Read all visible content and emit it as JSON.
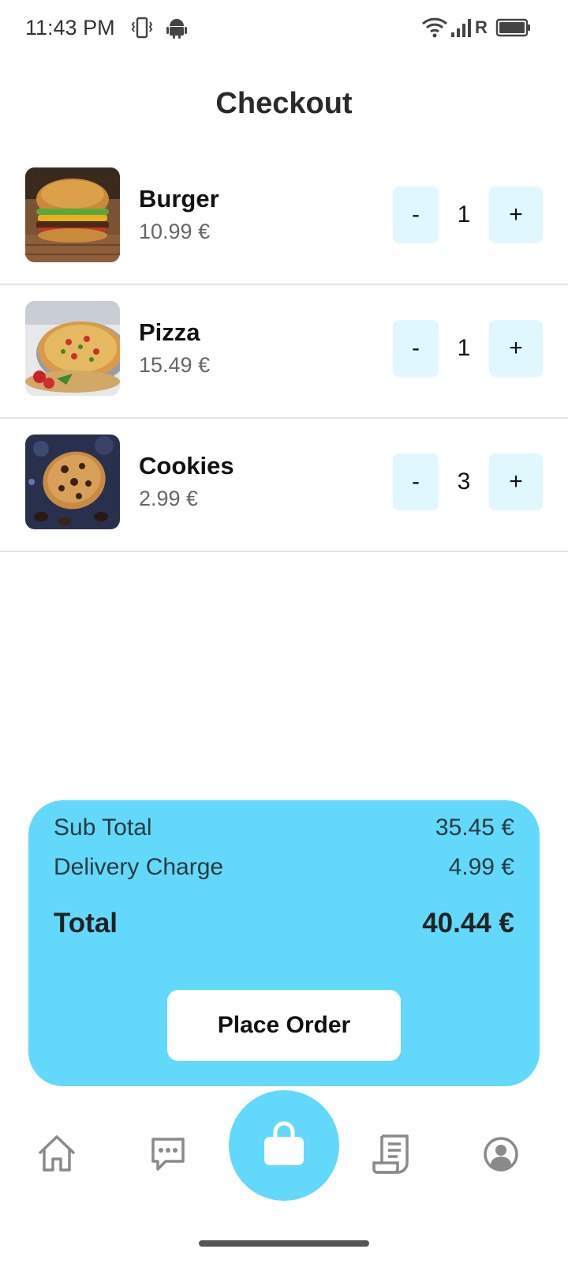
{
  "status_bar": {
    "time": "11:43 PM",
    "icons": [
      "vibrate-icon",
      "android-icon",
      "wifi-icon",
      "signal-icon",
      "battery-icon"
    ],
    "roaming_label": "R"
  },
  "page": {
    "title": "Checkout"
  },
  "cart": {
    "items": [
      {
        "name": "Burger",
        "price": "10.99 €",
        "quantity": "1",
        "minus_label": "-",
        "plus_label": "+",
        "image": "burger-image"
      },
      {
        "name": "Pizza",
        "price": "15.49 €",
        "quantity": "1",
        "minus_label": "-",
        "plus_label": "+",
        "image": "pizza-image"
      },
      {
        "name": "Cookies",
        "price": "2.99 €",
        "quantity": "3",
        "minus_label": "-",
        "plus_label": "+",
        "image": "cookies-image"
      }
    ]
  },
  "summary": {
    "subtotal_label": "Sub Total",
    "subtotal_value": "35.45 €",
    "delivery_label": "Delivery Charge",
    "delivery_value": "4.99 €",
    "total_label": "Total",
    "total_value": "40.44 €",
    "place_order_label": "Place Order"
  },
  "bottom_nav": {
    "items": [
      "home-icon",
      "chat-icon",
      "bag-icon",
      "receipt-icon",
      "profile-icon"
    ],
    "active": "bag-icon"
  },
  "colors": {
    "accent": "#62d9fa",
    "qty_button_bg": "#e0f7fd",
    "divider": "#e3e3e3"
  }
}
